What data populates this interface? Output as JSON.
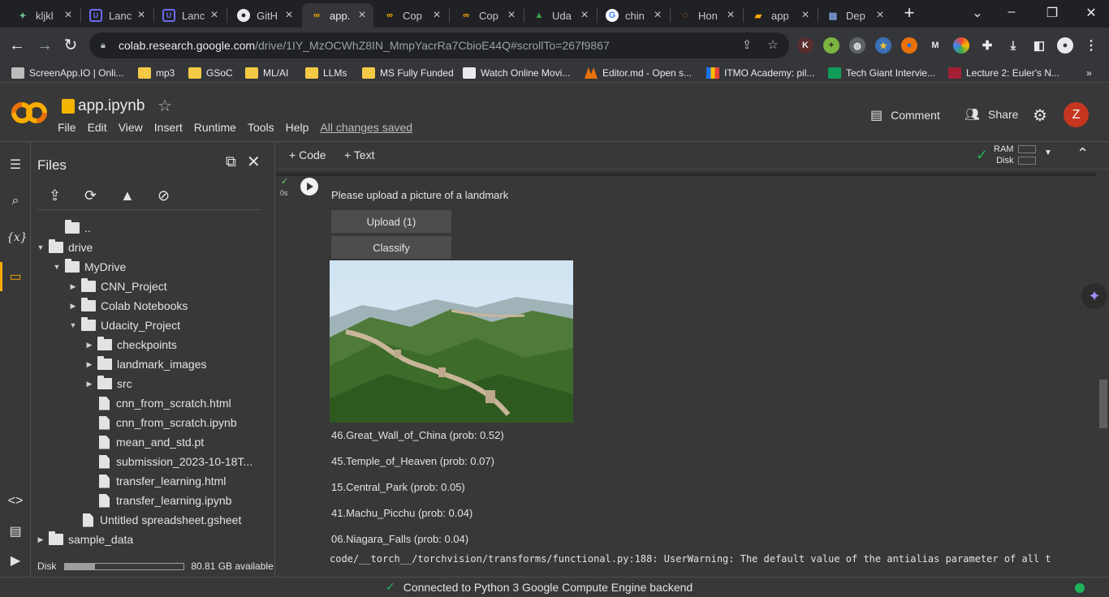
{
  "browser": {
    "tabs": [
      {
        "label": "kljkl",
        "icon": "gradio-icon"
      },
      {
        "label": "Lanc",
        "icon": "udacity-icon"
      },
      {
        "label": "Lanc",
        "icon": "udacity-icon"
      },
      {
        "label": "GitH",
        "icon": "github-icon"
      },
      {
        "label": "app.",
        "icon": "colab-icon"
      },
      {
        "label": "Cop",
        "icon": "colab-icon"
      },
      {
        "label": "Cop",
        "icon": "colab-icon"
      },
      {
        "label": "Uda",
        "icon": "google-drive-icon"
      },
      {
        "label": "chin",
        "icon": "google-icon"
      },
      {
        "label": "Hon",
        "icon": "jupyter-icon"
      },
      {
        "label": "app",
        "icon": "book-icon"
      },
      {
        "label": "Dep",
        "icon": "docs-icon"
      }
    ],
    "url_host": "colab.research.google.com",
    "url_path": "/drive/1IY_MzOCWhZ8IN_MmpYacrRa7CbioE44Q#scrollTo=267f9867",
    "bookmarks": [
      "ScreenApp.IO | Onli...",
      "mp3",
      "GSoC",
      "ML/AI",
      "LLMs",
      "MS Fully Funded",
      "Watch Online Movi...",
      "Editor.md - Open s...",
      "ITMO Academy: pil...",
      "Tech Giant Intervie...",
      "Lecture 2: Euler's N..."
    ],
    "bookmarks_more": "»"
  },
  "colab": {
    "notebook_name": "app.ipynb",
    "menu": [
      "File",
      "Edit",
      "View",
      "Insert",
      "Runtime",
      "Tools",
      "Help"
    ],
    "save_status": "All changes saved",
    "comment_label": "Comment",
    "share_label": "Share",
    "avatar_letter": "Z",
    "add_code": "Code",
    "add_text": "Text",
    "ram_label": "RAM",
    "disk_label": "Disk"
  },
  "files": {
    "title": "Files",
    "tree": [
      {
        "label": "..",
        "depth": 1,
        "kind": "up",
        "caret": ""
      },
      {
        "label": "drive",
        "depth": 0,
        "kind": "folder",
        "caret": "open"
      },
      {
        "label": "MyDrive",
        "depth": 1,
        "kind": "folder",
        "caret": "open"
      },
      {
        "label": "CNN_Project",
        "depth": 2,
        "kind": "folder",
        "caret": "closed"
      },
      {
        "label": "Colab Notebooks",
        "depth": 2,
        "kind": "folder",
        "caret": "closed"
      },
      {
        "label": "Udacity_Project",
        "depth": 2,
        "kind": "folder",
        "caret": "open"
      },
      {
        "label": "checkpoints",
        "depth": 3,
        "kind": "folder",
        "caret": "closed"
      },
      {
        "label": "landmark_images",
        "depth": 3,
        "kind": "folder",
        "caret": "closed"
      },
      {
        "label": "src",
        "depth": 3,
        "kind": "folder",
        "caret": "closed"
      },
      {
        "label": "cnn_from_scratch.html",
        "depth": 3,
        "kind": "file",
        "caret": ""
      },
      {
        "label": "cnn_from_scratch.ipynb",
        "depth": 3,
        "kind": "file",
        "caret": ""
      },
      {
        "label": "mean_and_std.pt",
        "depth": 3,
        "kind": "file",
        "caret": ""
      },
      {
        "label": "submission_2023-10-18T...",
        "depth": 3,
        "kind": "file",
        "caret": ""
      },
      {
        "label": "transfer_learning.html",
        "depth": 3,
        "kind": "file",
        "caret": ""
      },
      {
        "label": "transfer_learning.ipynb",
        "depth": 3,
        "kind": "file",
        "caret": ""
      },
      {
        "label": "Untitled spreadsheet.gsheet",
        "depth": 2,
        "kind": "file",
        "caret": ""
      },
      {
        "label": "sample_data",
        "depth": 0,
        "kind": "folder",
        "caret": "closed"
      }
    ],
    "disk_label": "Disk",
    "disk_available": "80.81 GB available",
    "disk_used_fraction": 0.25
  },
  "cell": {
    "exec_time": "0s",
    "prompt": "Please upload a picture of a landmark",
    "upload_label": "Upload (1)",
    "classify_label": "Classify",
    "predictions": [
      "46.Great_Wall_of_China (prob: 0.52)",
      "45.Temple_of_Heaven (prob: 0.07)",
      "15.Central_Park (prob: 0.05)",
      "41.Machu_Picchu (prob: 0.04)",
      "06.Niagara_Falls (prob: 0.04)"
    ],
    "warning": "code/__torch__/torchvision/transforms/functional.py:188: UserWarning: The default value of the antialias parameter of all t"
  },
  "status": {
    "text": "Connected to Python 3 Google Compute Engine backend"
  },
  "colors": {
    "accent_orange": "#f9ab00",
    "connected_green": "#1fb35a",
    "avatar_red": "#c5351f"
  }
}
